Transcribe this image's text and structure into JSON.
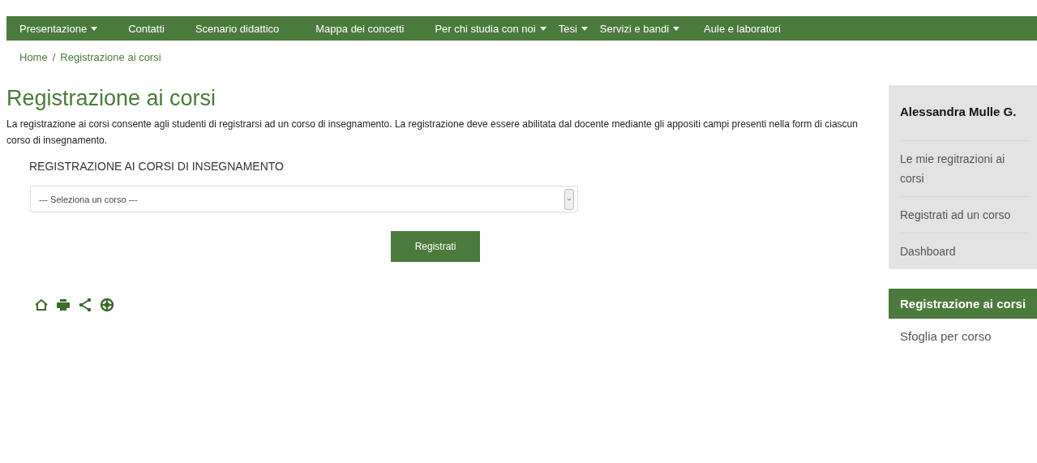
{
  "nav": [
    {
      "label": "Presentazione",
      "dropdown": true
    },
    {
      "label": "Contatti",
      "dropdown": false
    },
    {
      "label": "Scenario didattico",
      "dropdown": false
    },
    {
      "label": "Mappa dei concetti",
      "dropdown": false
    },
    {
      "label": "Per chi studia con noi",
      "dropdown": true
    },
    {
      "label": "Tesi",
      "dropdown": true
    },
    {
      "label": "Servizi e bandi",
      "dropdown": true
    },
    {
      "label": "Aule e laboratori",
      "dropdown": false
    }
  ],
  "breadcrumb": {
    "items": [
      "Home",
      "Registrazione ai corsi"
    ],
    "separator": "/"
  },
  "title": "Registrazione ai corsi",
  "description": "La registrazione ai corsi consente agli studenti di registrarsi ad un corso di insegnamento. La registrazione deve essere abilitata dal docente mediante gli appositi campi presenti nella form di ciascun corso di insegnamento.",
  "form": {
    "heading": "REGISTRAZIONE AI CORSI DI INSEGNAMENTO",
    "select_value": "--- Seleziona un corso ---",
    "button": "Registrati"
  },
  "user_panel": {
    "name": "Alessandra Mulle G.",
    "items": [
      "Le mie regitrazioni ai corsi",
      "Registrati ad un corso",
      "Dashboard"
    ]
  },
  "sidebar_links": [
    {
      "label": "Registrazione ai corsi",
      "selected": true
    },
    {
      "label": "Sfoglia per corso",
      "selected": false
    }
  ]
}
